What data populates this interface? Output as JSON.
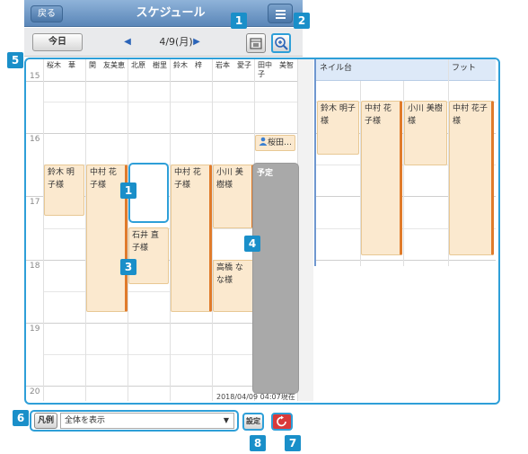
{
  "header": {
    "back_label": "戻る",
    "title": "スケジュール"
  },
  "toolbar": {
    "today_label": "今日",
    "date": "4/9(月)"
  },
  "staff_columns": [
    "桜木　華",
    "関　友美恵",
    "北原　樹里",
    "鈴木　梓",
    "岩本　愛子",
    "田中　美智子"
  ],
  "resource_columns": [
    "ネイル台",
    "フット"
  ],
  "hours": [
    "15",
    "16",
    "17",
    "18",
    "19",
    "20"
  ],
  "events": {
    "sakuragi_1": "鈴木 明子様",
    "seki_1": "中村 花子様",
    "kitahara_1": "石井 直子様",
    "suzuki_1": "中村 花子様",
    "iwamoto_1": "小川 美樹様",
    "iwamoto_2": "高橋 なな様",
    "tanaka_chip": "桜田…",
    "tanaka_block": "予定",
    "nail_1": "鈴木 明子様",
    "nail_2": "中村 花子様",
    "nail_3": "小川 美樹様",
    "foot_1": "中村 花子様"
  },
  "timestamp": "2018/04/09 04:07現在",
  "footer": {
    "legend_label": "凡例",
    "filter_value": "全体を表示",
    "settings_label": "設定"
  },
  "badges": [
    "1",
    "2",
    "1",
    "4",
    "3",
    "5",
    "6",
    "8",
    "7"
  ],
  "colors": {
    "accent": "#2e9fd8",
    "badge": "#1a8fc9",
    "event_bg": "#fbe9cf",
    "event_stripe": "#e07b2b",
    "refresh": "#d93a3a"
  }
}
